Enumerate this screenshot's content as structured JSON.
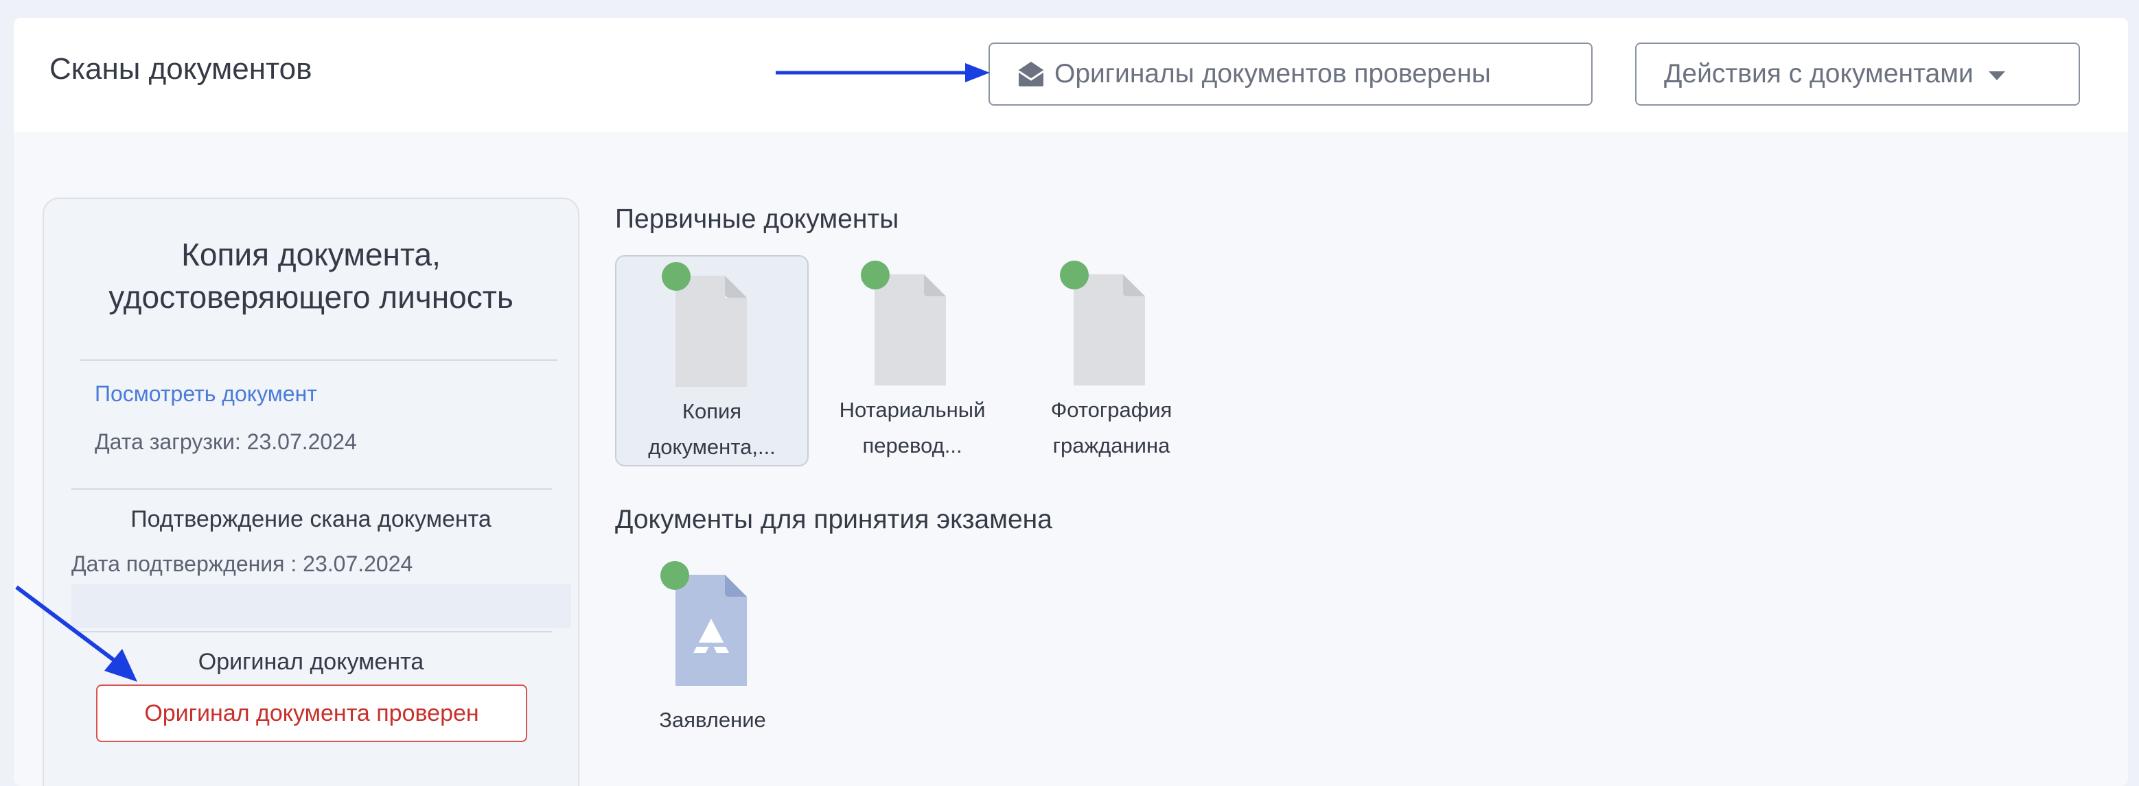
{
  "header": {
    "title": "Сканы документов",
    "originals_verified_button": "Оригиналы документов проверены",
    "actions_button": "Действия с документами"
  },
  "side_panel": {
    "title_line1": "Копия документа,",
    "title_line2": "удостоверяющего личность",
    "view_link": "Посмотреть документ",
    "upload_date": "Дата загрузки: 23.07.2024",
    "scan_confirmation_heading": "Подтверждение скана документа",
    "confirmation_date": "Дата подтверждения : 23.07.2024",
    "original_heading": "Оригинал документа",
    "original_verified_button": "Оригинал документа проверен"
  },
  "primary_documents": {
    "title": "Первичные документы",
    "items": [
      {
        "line1": "Копия",
        "line2": "документа,...",
        "status": "green"
      },
      {
        "line1": "Нотариальный",
        "line2": "перевод...",
        "status": "green"
      },
      {
        "line1": "Фотография",
        "line2": "гражданина",
        "status": "green"
      }
    ]
  },
  "exam_documents": {
    "title": "Документы для принятия экзамена",
    "items": [
      {
        "line1": "Заявление",
        "status": "green"
      }
    ]
  },
  "colors": {
    "status_ok": "#6cb36e",
    "annotation_arrow": "#1a3fe0",
    "danger": "#d9534f",
    "link": "#4a7bd8"
  },
  "icons": [
    "envelope-open-icon",
    "file-icon",
    "file-pdf-icon",
    "status-dot-icon",
    "arrow-annotation-icon"
  ]
}
